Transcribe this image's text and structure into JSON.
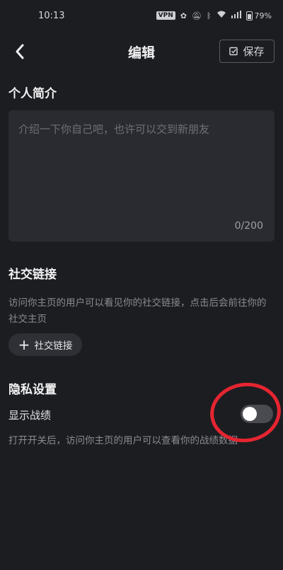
{
  "status_bar": {
    "time": "10:13",
    "vpn": "VPN",
    "battery": "79%"
  },
  "header": {
    "title": "编辑",
    "save_label": "保存"
  },
  "bio": {
    "section_title": "个人简介",
    "placeholder": "介绍一下你自己吧，也许可以交到新朋友",
    "counter": "0/200"
  },
  "social": {
    "section_title": "社交链接",
    "description": "访问你主页的用户可以看见你的社交链接，点击后会前往你的社交主页",
    "add_button": "社交链接"
  },
  "privacy": {
    "section_title": "隐私设置",
    "toggle_label": "显示战绩",
    "toggle_on": false,
    "toggle_description": "打开开关后，访问你主页的用户可以查看你的战绩数据"
  },
  "colors": {
    "background": "#1c1d21",
    "annotation": "#e52531"
  }
}
